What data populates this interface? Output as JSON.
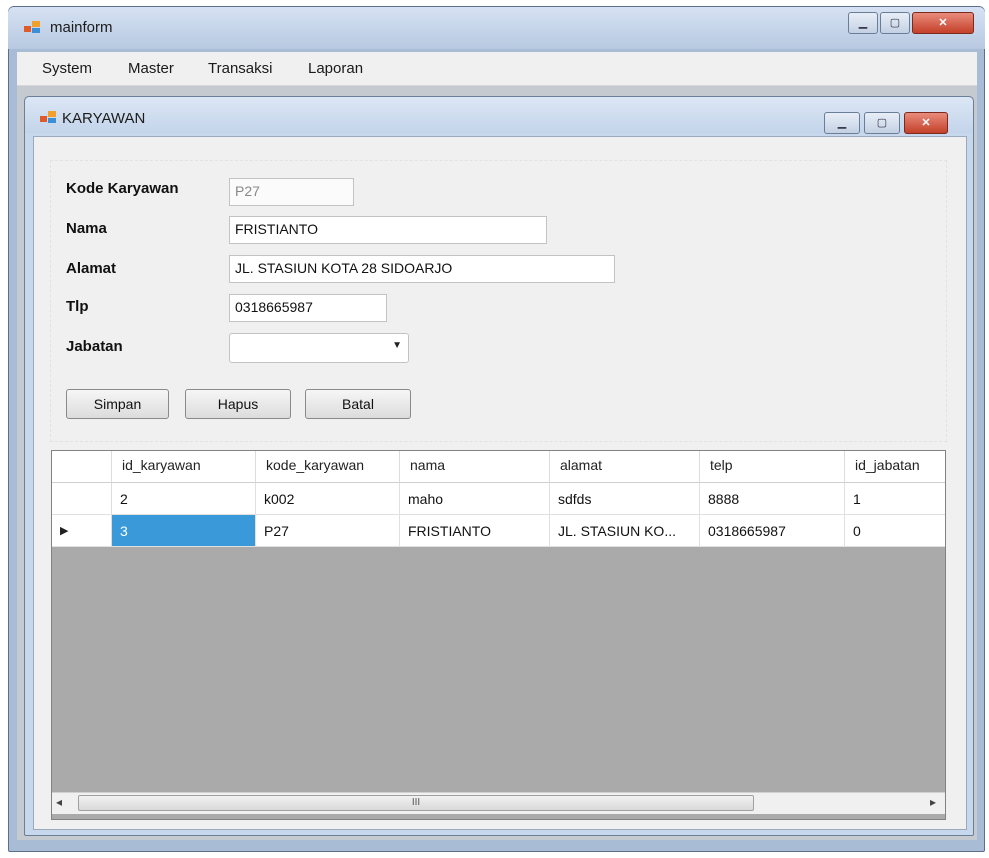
{
  "main_window": {
    "title": "mainform",
    "menu": [
      "System",
      "Master",
      "Transaksi",
      "Laporan"
    ]
  },
  "child_window": {
    "title": "KARYAWAN"
  },
  "form": {
    "kode_label": "Kode Karyawan",
    "kode_value": "P27",
    "nama_label": "Nama",
    "nama_value": "FRISTIANTO",
    "alamat_label": "Alamat",
    "alamat_value": "JL. STASIUN KOTA 28 SIDOARJO",
    "tlp_label": "Tlp",
    "tlp_value": "0318665987",
    "jabatan_label": "Jabatan",
    "jabatan_value": ""
  },
  "buttons": {
    "simpan": "Simpan",
    "hapus": "Hapus",
    "batal": "Batal"
  },
  "grid": {
    "columns": [
      "id_karyawan",
      "kode_karyawan",
      "nama",
      "alamat",
      "telp",
      "id_jabatan"
    ],
    "rows": [
      [
        "2",
        "k002",
        "maho",
        "sdfds",
        "8888",
        "1"
      ],
      [
        "3",
        "P27",
        "FRISTIANTO",
        "JL. STASIUN KO...",
        "0318665987",
        "0"
      ]
    ],
    "current_row_marker": "▶",
    "selected_cell_color": "#3a9ad9"
  },
  "scrollbar": {
    "left_arrow": "◂",
    "right_arrow": "▸",
    "grip": "III"
  },
  "colors": {
    "title_bar": "#c3d4ea",
    "close_button": "#c4402a",
    "grid_empty_area": "#aaaaaa"
  }
}
